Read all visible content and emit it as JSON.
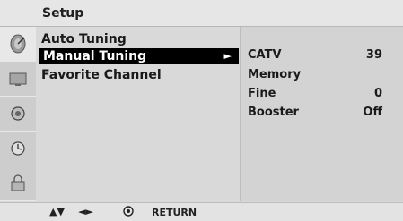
{
  "header": {
    "title": "Setup"
  },
  "menu": {
    "items": [
      {
        "label": "Auto Tuning"
      },
      {
        "label": "Manual Tuning",
        "arrow": "►"
      },
      {
        "label": "Favorite Channel"
      }
    ],
    "selected": "Manual Tuning"
  },
  "submenu": {
    "rows": [
      {
        "label": "CATV",
        "value": "39"
      },
      {
        "label": "Memory",
        "value": ""
      },
      {
        "label": "Fine",
        "value": "0"
      },
      {
        "label": "Booster",
        "value": "Off"
      }
    ]
  },
  "side_icons": [
    "antenna-dish-icon",
    "tv-picture-icon",
    "speaker-icon",
    "clock-icon",
    "lock-icon"
  ],
  "footer": {
    "nav_updown": "▲▼",
    "nav_leftright": "◄►",
    "ok_icon": "ok-circle-icon",
    "return_label": "RETURN"
  },
  "colors": {
    "background": "#d9d9d9",
    "selected_bg": "#000000",
    "selected_text": "#ffffff"
  }
}
